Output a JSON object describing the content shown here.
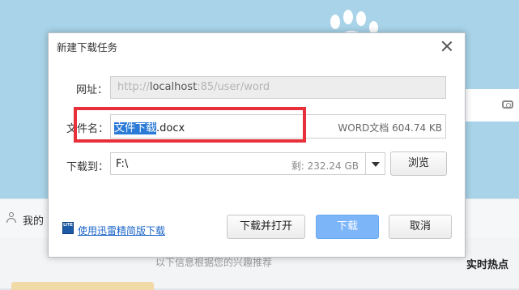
{
  "background": {
    "my_label": "我的",
    "hint_text": "以下信息根据您的兴趣推荐",
    "hot_label": "实时热点"
  },
  "dialog": {
    "title": "新建下载任务",
    "url_label": "网址：",
    "url_host_prefix": "http://",
    "url_host": "localhost",
    "url_rest": ":85/user/word",
    "name_label": "文件名：",
    "name_selected": "文件下载",
    "name_ext": ".docx",
    "file_info": "WORD文档 604.74 KB",
    "dir_label": "下载到：",
    "dir_path": "F:\\",
    "dir_free": "剩: 232.24 GB",
    "browse_label": "浏览",
    "lite_icon_text": "LITE",
    "lite_link": "使用迅雷精简版下载",
    "open_label": "下载并打开",
    "download_label": "下载",
    "cancel_label": "取消"
  },
  "colors": {
    "accent_blue": "#7cb5f8",
    "selection": "#2a7ad6",
    "highlight_red": "#e8303a",
    "link": "#1a64c9"
  }
}
